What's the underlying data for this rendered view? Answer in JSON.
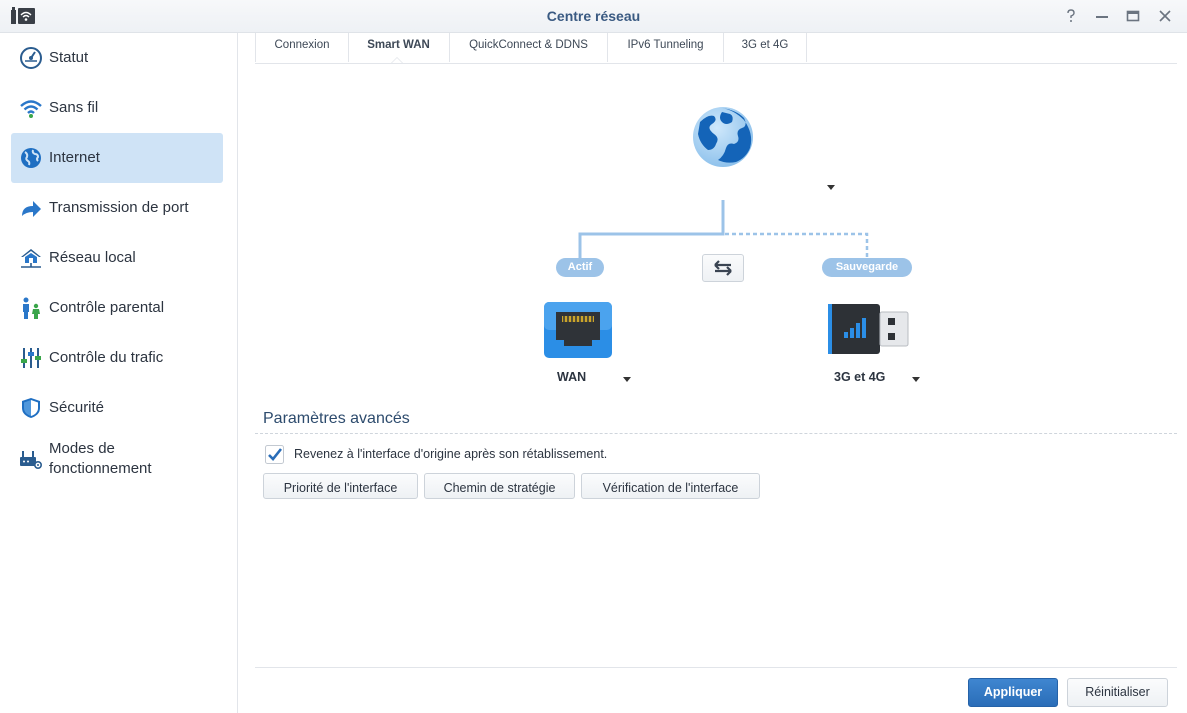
{
  "window": {
    "title": "Centre réseau"
  },
  "window_controls": [
    "help-icon",
    "minimize-icon",
    "maximize-icon",
    "close-icon"
  ],
  "sidebar": {
    "items": [
      {
        "label": "Statut",
        "icon": "speedometer-icon",
        "active": false
      },
      {
        "label": "Sans fil",
        "icon": "wifi-icon",
        "active": false
      },
      {
        "label": "Internet",
        "icon": "globe-icon",
        "active": true
      },
      {
        "label": "Transmission de port",
        "icon": "forward-arrow-icon",
        "active": false
      },
      {
        "label": "Réseau local",
        "icon": "home-network-icon",
        "active": false
      },
      {
        "label": "Contrôle parental",
        "icon": "family-icon",
        "active": false
      },
      {
        "label": "Contrôle du trafic",
        "icon": "sliders-icon",
        "active": false
      },
      {
        "label": "Sécurité",
        "icon": "shield-icon",
        "active": false
      },
      {
        "label": "Modes de fonctionnement",
        "icon": "router-gear-icon",
        "active": false
      }
    ]
  },
  "tabs": [
    {
      "label": "Connexion",
      "active": false
    },
    {
      "label": "Smart WAN",
      "active": true
    },
    {
      "label": "QuickConnect & DDNS",
      "active": false
    },
    {
      "label": "IPv6 Tunneling",
      "active": false
    },
    {
      "label": "3G et 4G",
      "active": false
    }
  ],
  "diagram": {
    "primary_badge": "Actif",
    "backup_badge": "Sauvegarde",
    "primary_interface": "WAN",
    "backup_interface": "3G et 4G"
  },
  "advanced": {
    "title": "Paramètres avancés",
    "checkbox_label": "Revenez à l'interface d'origine après son rétablissement.",
    "checkbox_checked": true,
    "buttons": {
      "priority": "Priorité de l'interface",
      "policy": "Chemin de stratégie",
      "check": "Vérification de l'interface"
    }
  },
  "footer": {
    "apply": "Appliquer",
    "reset": "Réinitialiser"
  },
  "colors": {
    "accent": "#2a6db8",
    "active_bg": "#cfe3f6",
    "badge": "#9cc3e8",
    "link_line": "#9cc3e8"
  }
}
